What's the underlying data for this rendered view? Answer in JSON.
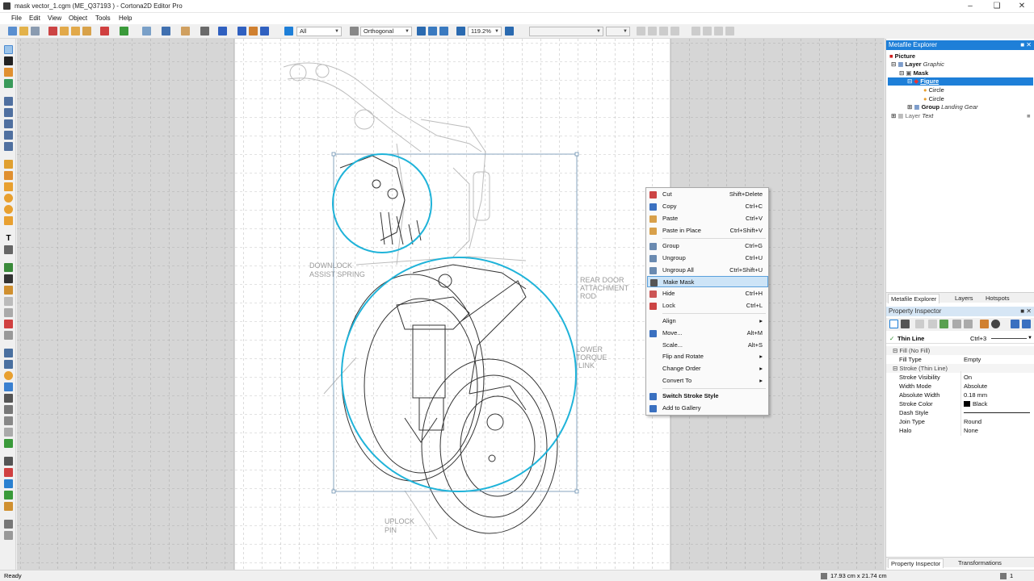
{
  "window": {
    "title": "mask vector_1.cgm (ME_Q37193                    ) - Cortona2D Editor Pro"
  },
  "menu": [
    "File",
    "Edit",
    "View",
    "Object",
    "Tools",
    "Help"
  ],
  "toolbar": {
    "filter": "All",
    "mode": "Orthogonal",
    "zoom": "119.2%"
  },
  "explorer": {
    "title": "Metafile Explorer",
    "items": [
      {
        "label": "Picture",
        "sub": ""
      },
      {
        "label": "Layer",
        "sub": "Graphic"
      },
      {
        "label": "Mask",
        "sub": ""
      },
      {
        "label": "Figure",
        "sub": ""
      },
      {
        "label": "Circle",
        "sub": ""
      },
      {
        "label": "Circle",
        "sub": ""
      },
      {
        "label": "Group",
        "sub": "Landing Gear"
      },
      {
        "label": "Layer",
        "sub": "Text"
      }
    ],
    "tabs": [
      "Metafile Explorer",
      "Layers",
      "Hotspots"
    ]
  },
  "inspector": {
    "title": "Property Inspector",
    "style_name": "Thin Line",
    "style_shortcut": "Ctrl+3",
    "sections": [
      {
        "name": "Fill (No Fill)",
        "rows": [
          {
            "k": "Fill Type",
            "v": "Empty"
          }
        ]
      },
      {
        "name": "Stroke (Thin Line)",
        "rows": [
          {
            "k": "Stroke Visibility",
            "v": "On"
          },
          {
            "k": "Width Mode",
            "v": "Absolute"
          },
          {
            "k": "Absolute Width",
            "v": "0.18 mm"
          },
          {
            "k": "Stroke Color",
            "v": "Black"
          },
          {
            "k": "Dash Style",
            "v": ""
          },
          {
            "k": "Join Type",
            "v": "Round"
          },
          {
            "k": "Halo",
            "v": "None"
          }
        ]
      }
    ],
    "tabs": [
      "Property Inspector",
      "Transformations"
    ]
  },
  "context_menu": [
    {
      "label": "Cut",
      "shortcut": "Shift+Delete",
      "icon": "cut-icon"
    },
    {
      "label": "Copy",
      "shortcut": "Ctrl+C",
      "icon": "copy-icon"
    },
    {
      "label": "Paste",
      "shortcut": "Ctrl+V",
      "icon": "paste-icon"
    },
    {
      "label": "Paste in Place",
      "shortcut": "Ctrl+Shift+V",
      "icon": "paste-in-place-icon"
    },
    {
      "sep": true
    },
    {
      "label": "Group",
      "shortcut": "Ctrl+G",
      "icon": "group-icon"
    },
    {
      "label": "Ungroup",
      "shortcut": "Ctrl+U",
      "icon": "ungroup-icon"
    },
    {
      "label": "Ungroup All",
      "shortcut": "Ctrl+Shift+U",
      "icon": "ungroup-all-icon"
    },
    {
      "label": "Make Mask",
      "shortcut": "",
      "icon": "mask-icon",
      "highlight": true
    },
    {
      "label": "Hide",
      "shortcut": "Ctrl+H",
      "icon": "hide-icon"
    },
    {
      "label": "Lock",
      "shortcut": "Ctrl+L",
      "icon": "lock-icon"
    },
    {
      "sep": true
    },
    {
      "label": "Align",
      "shortcut": "▸",
      "icon": ""
    },
    {
      "label": "Move...",
      "shortcut": "Alt+M",
      "icon": "move-icon"
    },
    {
      "label": "Scale...",
      "shortcut": "Alt+S",
      "icon": ""
    },
    {
      "label": "Flip and Rotate",
      "shortcut": "▸",
      "icon": ""
    },
    {
      "label": "Change Order",
      "shortcut": "▸",
      "icon": ""
    },
    {
      "label": "Convert To",
      "shortcut": "▸",
      "icon": ""
    },
    {
      "sep": true
    },
    {
      "label": "Switch Stroke Style",
      "shortcut": "",
      "icon": "stroke-style-icon",
      "bold": true
    },
    {
      "label": "Add to Gallery",
      "shortcut": "",
      "icon": "gallery-icon"
    }
  ],
  "callouts": {
    "downlock": [
      "DOWNLOCK",
      "ASSIST SPRING"
    ],
    "reardoor": [
      "REAR DOOR",
      "ATTACHMENT",
      "ROD"
    ],
    "lowertorque": [
      "LOWER",
      "TORQUE",
      "LINK"
    ],
    "uplock": [
      "UPLOCK",
      "PIN"
    ]
  },
  "status": {
    "left": "Ready",
    "size": "17.93 cm x 21.74 cm",
    "page": "1"
  },
  "colors": {
    "accent": "#1e7fd8",
    "selection": "#1fb3d9"
  }
}
